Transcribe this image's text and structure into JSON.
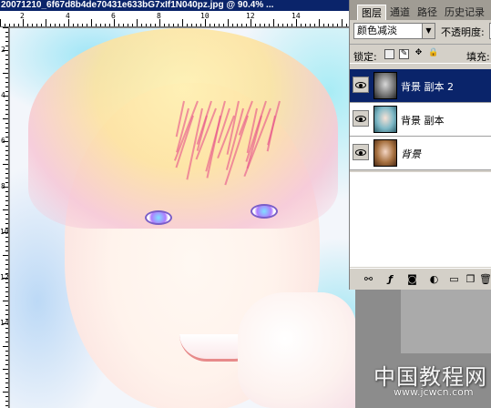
{
  "document": {
    "title": "20071210_6f67d8b4de70431e633bG7xIf1N040pz.jpg @ 90.4% ...",
    "ruler_top_labels": [
      "2",
      "4",
      "6",
      "8",
      "10",
      "12",
      "14"
    ],
    "ruler_left_labels": [
      "2",
      "4",
      "6",
      "8",
      "10",
      "12",
      "14"
    ]
  },
  "layers_panel": {
    "tabs": [
      {
        "label": "图层",
        "active": true
      },
      {
        "label": "通道",
        "active": false
      },
      {
        "label": "路径",
        "active": false
      },
      {
        "label": "历史记录",
        "active": false
      }
    ],
    "blend_mode": "颜色减淡",
    "opacity_label": "不透明度:",
    "lock_label": "锁定:",
    "fill_label": "填充:",
    "layers": [
      {
        "name": "背景 副本 2",
        "selected": true,
        "visible": true,
        "italic": false
      },
      {
        "name": "背景 副本",
        "selected": false,
        "visible": true,
        "italic": false
      },
      {
        "name": "背景",
        "selected": false,
        "visible": true,
        "italic": true
      }
    ]
  },
  "watermark": {
    "text": "中国教程网",
    "url": "www.jcwcn.com"
  },
  "colors": {
    "title_bar": "#0a246a",
    "selected_layer": "#0a246a",
    "panel_bg": "#d4d0c8"
  },
  "icons": [
    "lock-transparent-icon",
    "lock-paint-icon",
    "lock-move-icon",
    "lock-all-icon",
    "link-icon",
    "fx-icon",
    "mask-icon",
    "adjustment-icon",
    "folder-icon",
    "new-layer-icon",
    "trash-icon"
  ]
}
